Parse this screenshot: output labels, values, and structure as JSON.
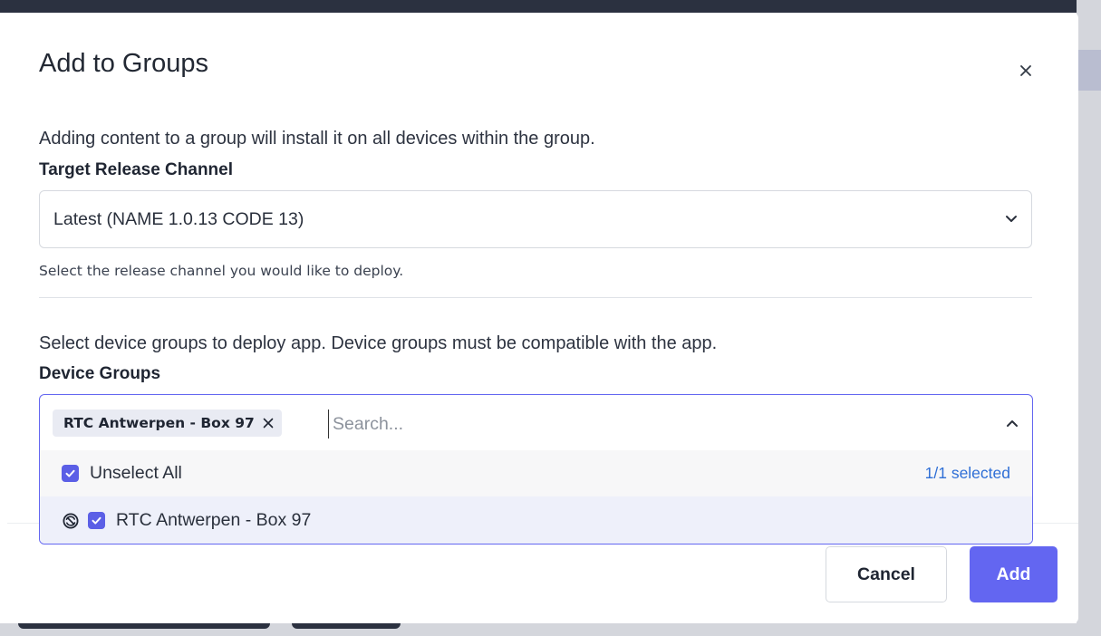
{
  "modal": {
    "title": "Add to Groups",
    "description": "Adding content to a group will install it on all devices within the group."
  },
  "release_channel": {
    "label": "Target Release Channel",
    "selected_value": "Latest (NAME 1.0.13 CODE 13)",
    "helper": "Select the release channel you would like to deploy."
  },
  "device_groups": {
    "description": "Select device groups to deploy app. Device groups must be compatible with the app.",
    "label": "Device Groups",
    "chips": [
      {
        "label": "RTC Antwerpen - Box 97"
      }
    ],
    "search_placeholder": "Search...",
    "unselect_all_label": "Unselect All",
    "selected_count": "1/1 selected",
    "options": [
      {
        "label": "RTC Antwerpen - Box 97",
        "checked": true,
        "icon": "sync-disabled-icon"
      }
    ]
  },
  "footer": {
    "cancel_label": "Cancel",
    "add_label": "Add"
  },
  "colors": {
    "accent": "#6366f1",
    "count_text": "#2f6fd6"
  },
  "icons": {
    "close": "close-icon",
    "dropdown": "chevron-down-icon",
    "collapse": "chevron-up-icon",
    "chip_remove": "remove-chip-icon",
    "checkbox": "checkbox-checked-icon"
  }
}
